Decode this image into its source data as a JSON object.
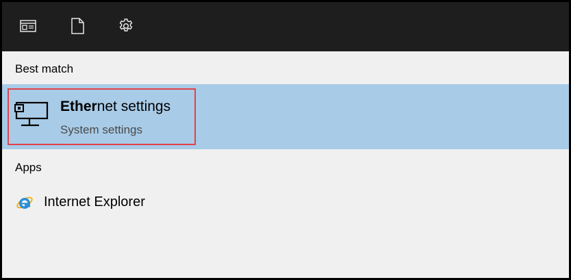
{
  "topbar": {
    "icons": [
      {
        "name": "apps-filter-icon"
      },
      {
        "name": "documents-filter-icon"
      },
      {
        "name": "settings-gear-icon"
      }
    ]
  },
  "best_match": {
    "section_label": "Best match",
    "result": {
      "title_bold": "Ether",
      "title_rest": "net settings",
      "subtitle": "System settings",
      "icon": "ethernet-network-icon",
      "highlight_color": "#e0424a",
      "background": "#a8cbe7"
    }
  },
  "apps": {
    "section_label": "Apps",
    "items": [
      {
        "label": "Internet Explorer",
        "icon": "internet-explorer-icon"
      }
    ]
  }
}
